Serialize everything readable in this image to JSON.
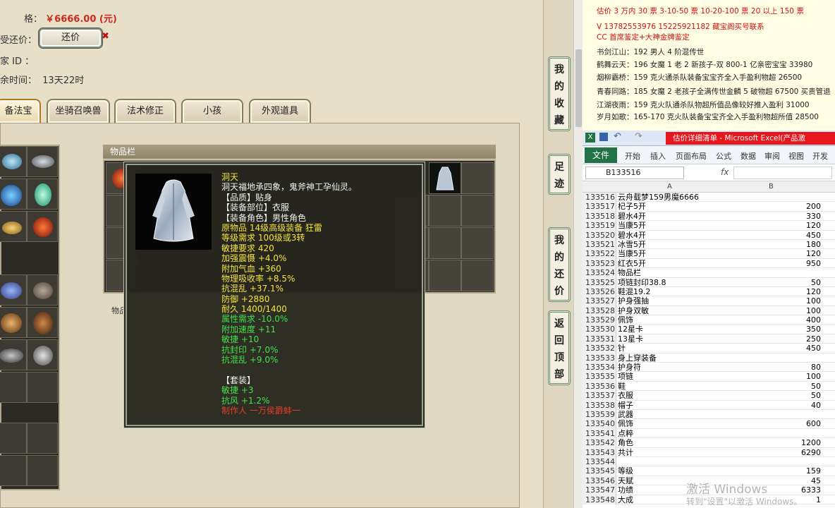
{
  "game": {
    "price_label": "格：",
    "price_value": "￥6666.00 (元)",
    "bargain_label": "受还价：",
    "bargain_button": "还价",
    "seller_id_label": "家 ID ：",
    "time_label": "余时间：",
    "time_value": "13天22时",
    "tabs": [
      "备法宝",
      "坐骑召唤兽",
      "法术修正",
      "小孩",
      "外观道具"
    ],
    "bag_title": "物品栏",
    "item_label": "物品"
  },
  "tooltip": {
    "lines": [
      {
        "text": "洞天",
        "color": "yellow"
      },
      {
        "text": "洞天福地承四象，鬼斧神工孕仙灵。",
        "color": "white"
      },
      {
        "text": "【品质】贴身",
        "color": "white"
      },
      {
        "text": "【装备部位】衣服",
        "color": "white"
      },
      {
        "text": "【装备角色】男性角色",
        "color": "white"
      },
      {
        "text": "原物品 14级高级装备 狂雷",
        "color": "yellow"
      },
      {
        "text": "等级需求 100级或3转",
        "color": "yellow"
      },
      {
        "text": "敏捷要求 420",
        "color": "yellow"
      },
      {
        "text": "加强震慑 +4.0%",
        "color": "yellow"
      },
      {
        "text": "附加气血 +360",
        "color": "yellow"
      },
      {
        "text": "物理吸收率 +8.5%",
        "color": "yellow"
      },
      {
        "text": "抗混乱 +37.1%",
        "color": "yellow"
      },
      {
        "text": "防御 +2880",
        "color": "yellow"
      },
      {
        "text": "耐久 1400/1400",
        "color": "yellow"
      },
      {
        "text": "属性需求 -10.0%",
        "color": "green"
      },
      {
        "text": "附加速度 +11",
        "color": "green"
      },
      {
        "text": "敏捷 +10",
        "color": "green"
      },
      {
        "text": "抗封印 +7.0%",
        "color": "green"
      },
      {
        "text": "抗混乱 +9.0%",
        "color": "green"
      },
      {
        "text": "",
        "color": "white"
      },
      {
        "text": "【套装】",
        "color": "white"
      },
      {
        "text": "敏捷 +3",
        "color": "green"
      },
      {
        "text": "抗风 +1.2%",
        "color": "green"
      },
      {
        "text": "制作人 一万侯爵蚌一",
        "color": "red"
      }
    ]
  },
  "sidebar": {
    "buttons": [
      {
        "chars": [
          "我",
          "的",
          "收",
          "藏"
        ]
      },
      {
        "chars": [
          "足",
          "迹"
        ]
      },
      {
        "chars": [
          "我",
          "的",
          "还",
          "价"
        ]
      },
      {
        "chars": [
          "返",
          "回",
          "顶",
          "部"
        ]
      }
    ]
  },
  "ad": {
    "lines": [
      {
        "text": "估价 3 万内 30 票   3-10-50 票   10-20-100 票   20 以上 150 票",
        "color": "red"
      },
      {
        "text": "V 13782553976    15225921182   藏宝阁买号联系",
        "color": "red"
      },
      {
        "text": "CC 首席鉴定+大神金牌鉴定",
        "color": "red"
      },
      {
        "text": "书剑江山：192 男人 4 阶混传世",
        "color": "dark"
      },
      {
        "text": "鹤舞云天：196 女魔 1 老 2 新孩子-双 800-1 亿亲密宝宝 33980",
        "color": "dark"
      },
      {
        "text": "烟柳霸桥：159 克火通杀队装备宝宝齐全入手盈利物超 26500",
        "color": "dark"
      },
      {
        "text": "青春同路：185 女魔 2 老孩子全满传世金麟 5 破物超 67500 买贵管退",
        "color": "dark"
      },
      {
        "text": "江湖夜雨：159 克火队通杀队物超所值品像较好推入盈利 31000",
        "color": "dark"
      },
      {
        "text": "岁月如歌：165-170 克火队装备宝宝齐全入手盈利物超所值 28500",
        "color": "dark"
      }
    ]
  },
  "excel": {
    "title": "估价详细清单 - Microsoft Excel(产品激",
    "menu": [
      "文件",
      "开始",
      "插入",
      "页面布局",
      "公式",
      "数据",
      "审阅",
      "视图",
      "开发工"
    ],
    "name_box": "B133516",
    "fx": "fx",
    "col_a": "A",
    "col_b": "B",
    "rows": [
      {
        "n": "133516",
        "a": "云舟载梦159男魔6666",
        "b": ""
      },
      {
        "n": "133517",
        "a": "杞子5开",
        "b": "200"
      },
      {
        "n": "133518",
        "a": "碧水4开",
        "b": "330"
      },
      {
        "n": "133519",
        "a": "当康5开",
        "b": "120"
      },
      {
        "n": "133520",
        "a": "碧水4开",
        "b": "450"
      },
      {
        "n": "133521",
        "a": "冰雪5开",
        "b": "180"
      },
      {
        "n": "133522",
        "a": "当康5开",
        "b": "120"
      },
      {
        "n": "133523",
        "a": "红衣5开",
        "b": "950"
      },
      {
        "n": "133524",
        "a": "物品栏",
        "b": ""
      },
      {
        "n": "133525",
        "a": "项链封印38.8",
        "b": "50"
      },
      {
        "n": "133526",
        "a": "鞋混19.2",
        "b": "120"
      },
      {
        "n": "133527",
        "a": "护身强抽",
        "b": "100"
      },
      {
        "n": "133528",
        "a": "护身双敏",
        "b": "100"
      },
      {
        "n": "133529",
        "a": "佩饰",
        "b": "400"
      },
      {
        "n": "133530",
        "a": "12星卡",
        "b": "350"
      },
      {
        "n": "133531",
        "a": "13星卡",
        "b": "250"
      },
      {
        "n": "133532",
        "a": "针",
        "b": "450"
      },
      {
        "n": "133533",
        "a": "身上穿装备",
        "b": ""
      },
      {
        "n": "133534",
        "a": "护身符",
        "b": "80"
      },
      {
        "n": "133535",
        "a": "项链",
        "b": "100"
      },
      {
        "n": "133536",
        "a": "鞋",
        "b": "50"
      },
      {
        "n": "133537",
        "a": "衣服",
        "b": "50"
      },
      {
        "n": "133538",
        "a": "帽子",
        "b": "40"
      },
      {
        "n": "133539",
        "a": "武器",
        "b": ""
      },
      {
        "n": "133540",
        "a": "佩饰",
        "b": "600"
      },
      {
        "n": "133541",
        "a": "点粹",
        "b": ""
      },
      {
        "n": "133542",
        "a": "角色",
        "b": "1200"
      },
      {
        "n": "133543",
        "a": "共计",
        "b": "6290"
      },
      {
        "n": "133544",
        "a": "",
        "b": ""
      },
      {
        "n": "133545",
        "a": "等级",
        "b": "159"
      },
      {
        "n": "133546",
        "a": "天赋",
        "b": "45"
      },
      {
        "n": "133547",
        "a": "功绩",
        "b": "6333"
      },
      {
        "n": "133548",
        "a": "大成",
        "b": "1"
      }
    ]
  },
  "watermark": {
    "line1": "激活 Windows",
    "line2": "转到\"设置\"以激活 Windows。"
  },
  "colors": {
    "price_red": "#d0281e",
    "excel_green": "#217346",
    "excel_title_red": "#e6161c"
  }
}
